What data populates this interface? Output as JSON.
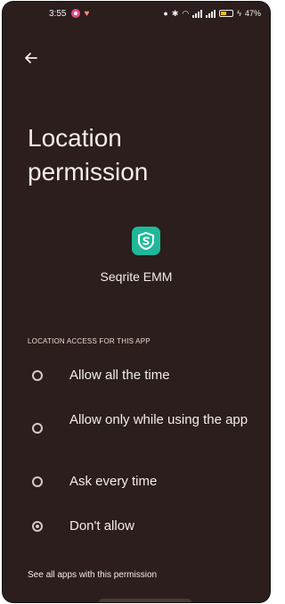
{
  "status_bar": {
    "time": "3:55",
    "battery_percent": "47%",
    "battery_level": 0.47,
    "icons": [
      "notification-dot-icon",
      "heart-icon",
      "record-icon",
      "bluetooth-icon",
      "wifi-icon",
      "volte-icon",
      "signal-icon",
      "signal-icon",
      "battery-icon",
      "charging-icon"
    ]
  },
  "header": {
    "back_icon": "back-arrow-icon"
  },
  "page": {
    "title": "Location permission"
  },
  "app": {
    "name": "Seqrite EMM",
    "icon": "seqrite-shield-icon",
    "icon_color": "#1fb89a"
  },
  "section": {
    "header": "LOCATION ACCESS FOR THIS APP"
  },
  "options": [
    {
      "label": "Allow all the time",
      "selected": false
    },
    {
      "label": "Allow only while using the app",
      "selected": false
    },
    {
      "label": "Ask every time",
      "selected": false
    },
    {
      "label": "Don't allow",
      "selected": true
    }
  ],
  "footer": {
    "link": "See all apps with this permission"
  },
  "colors": {
    "background": "#2b1e1c",
    "text": "#f3ecea",
    "accent": "#1fb89a"
  }
}
